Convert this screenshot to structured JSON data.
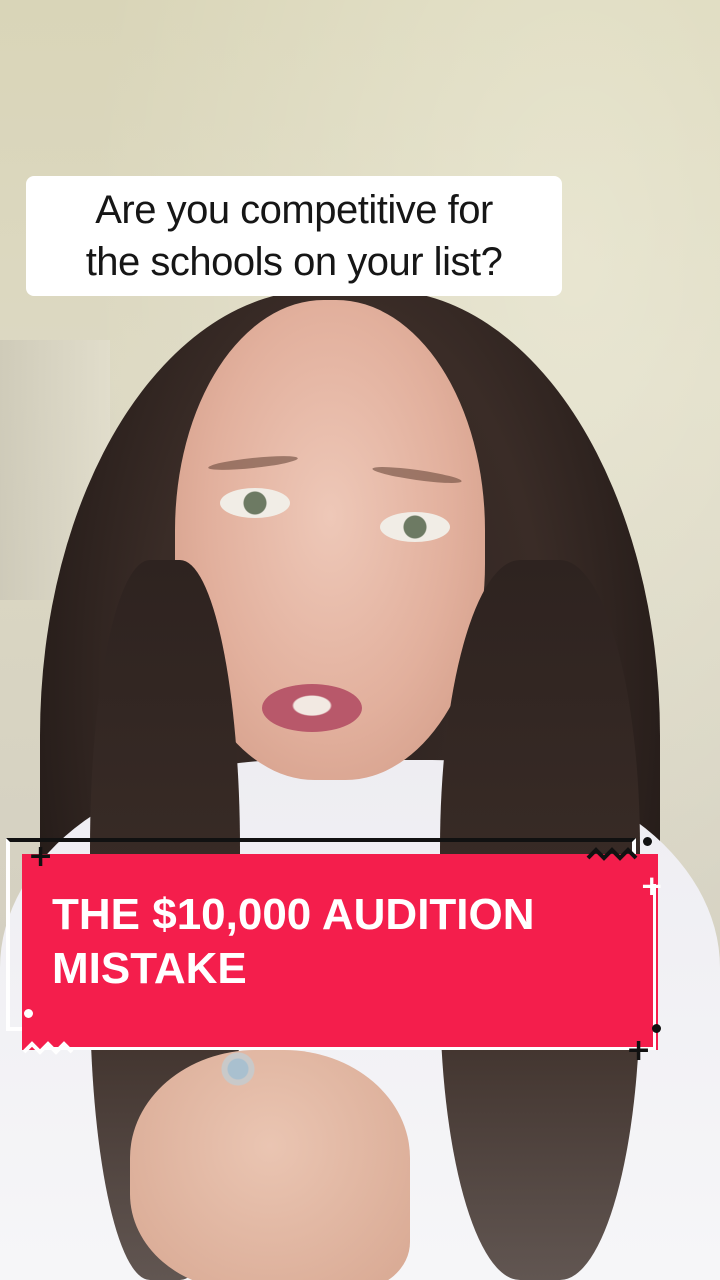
{
  "overlay": {
    "question_line1": "Are you competitive for",
    "question_line2": "the schools on your list?",
    "banner_line1": "THE $10,000 AUDITION",
    "banner_line2": "MISTAKE"
  },
  "colors": {
    "banner_background": "#f41e4c",
    "question_background": "#ffffff",
    "question_text": "#161616",
    "banner_text": "#ffffff"
  },
  "decorations": {
    "plus_symbol": "+"
  }
}
